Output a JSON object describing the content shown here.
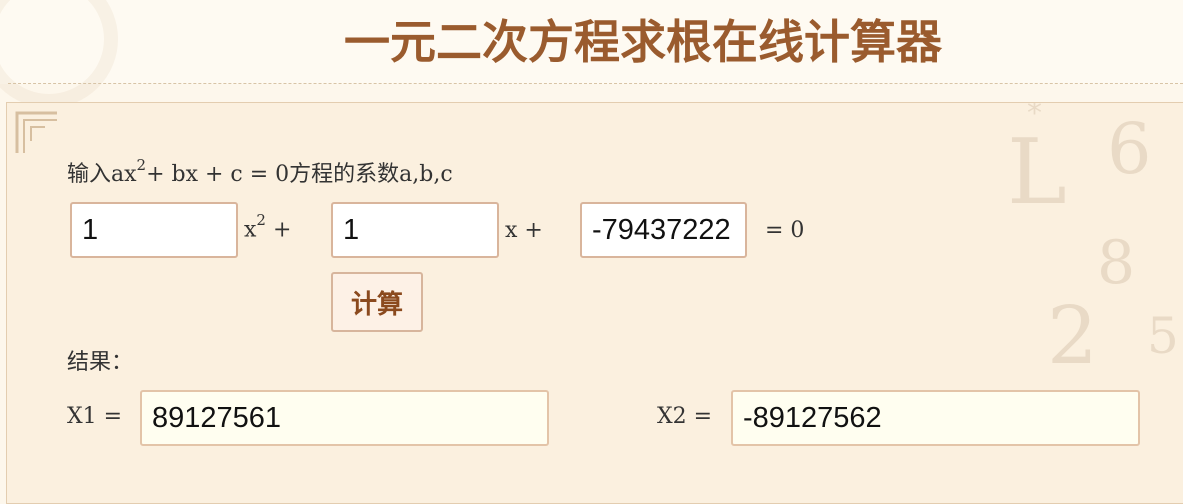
{
  "header": {
    "title": "一元二次方程求根在线计算器"
  },
  "form": {
    "prompt_prefix": "输入ax",
    "prompt_sup": "2",
    "prompt_suffix": "+ bx + c = 0方程的系数a,b,c",
    "a_value": "1",
    "b_value": "1",
    "c_value": "-79437222",
    "x2_term": "x",
    "x2_sup": "2",
    "x2_plus": " +",
    "x_term": "x +",
    "equals_zero": "= 0",
    "calc_label": "计算"
  },
  "results": {
    "label": "结果：",
    "x1_label": "X1 =",
    "x1_value": "89127561",
    "x2_label": "X2 =",
    "x2_value": "-89127562"
  },
  "colors": {
    "title": "#9a5b2e",
    "panel_bg": "#fbf0df",
    "button_text": "#8b4a1e",
    "field_border": "#d9b59c"
  }
}
